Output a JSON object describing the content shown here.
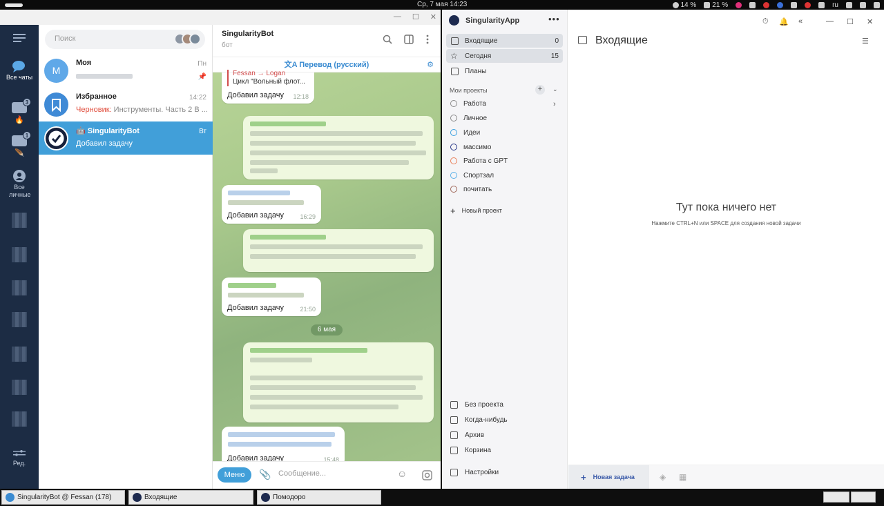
{
  "topbar": {
    "clock": "Ср, 7 мая  14:23",
    "battery1": "14 %",
    "battery2": "21 %",
    "lang": "ru"
  },
  "telegram": {
    "rail": {
      "all_chats": "Все чаты",
      "badge1": "3",
      "badge2": "1",
      "all_personal": "Все личные",
      "edit": "Ред."
    },
    "search_placeholder": "Поиск",
    "chats": [
      {
        "avatar_letter": "M",
        "name": "Моя",
        "time": "Пн",
        "preview": ""
      },
      {
        "name": "Избранное",
        "time": "14:22",
        "draft_label": "Черновик:",
        "preview": " Инструменты. Часть 2  В ..."
      },
      {
        "name": "SingularityBot",
        "time": "Вт",
        "preview": "Добавил задачу"
      }
    ],
    "header": {
      "title": "SingularityBot",
      "subtitle": "бот"
    },
    "translate_bar": "Перевод (русский)",
    "messages": [
      {
        "quote_name": "Fessan → Logan",
        "quote_text": "Цикл \"Вольный флот...",
        "text": "Добавил задачу",
        "time": "12:18"
      },
      {
        "text": "Добавил задачу",
        "time": "16:29"
      },
      {
        "text": "Добавил задачу",
        "time": "21:50"
      },
      {
        "text": "Добавил задачу",
        "time": "15:48"
      }
    ],
    "date_separator": "6 мая",
    "composer": {
      "menu": "Меню",
      "placeholder": "Сообщение..."
    }
  },
  "singularity": {
    "app_name": "SingularityApp",
    "nav": [
      {
        "label": "Входящие",
        "count": "0"
      },
      {
        "label": "Сегодня",
        "count": "15"
      },
      {
        "label": "Планы",
        "count": ""
      }
    ],
    "projects_label": "Мои проекты",
    "projects": [
      {
        "label": "Работа",
        "color": "#8a8a8a"
      },
      {
        "label": "Личное",
        "color": "#8a8a8a"
      },
      {
        "label": "Идеи",
        "color": "#3aa0e0"
      },
      {
        "label": "массимо",
        "color": "#2a3a8a"
      },
      {
        "label": "Работа с GPT",
        "color": "#e8805a"
      },
      {
        "label": "Спортзал",
        "color": "#5ab0e8"
      },
      {
        "label": "почитать",
        "color": "#a0685a"
      }
    ],
    "new_project": "Новый проект",
    "bottom_nav": [
      "Без проекта",
      "Когда-нибудь",
      "Архив",
      "Корзина",
      "Настройки"
    ],
    "main_title": "Входящие",
    "empty_title": "Тут пока ничего нет",
    "empty_hint": "Нажмите CTRL+N или SPACE для создания новой задачи",
    "new_task": "Новая задача"
  },
  "taskbar": [
    {
      "label": "SingularityBot @ Fessan (178)",
      "icon": "telegram-icon"
    },
    {
      "label": "Входящие",
      "icon": "singularity-icon"
    },
    {
      "label": "Помодоро",
      "icon": "singularity-icon"
    }
  ]
}
